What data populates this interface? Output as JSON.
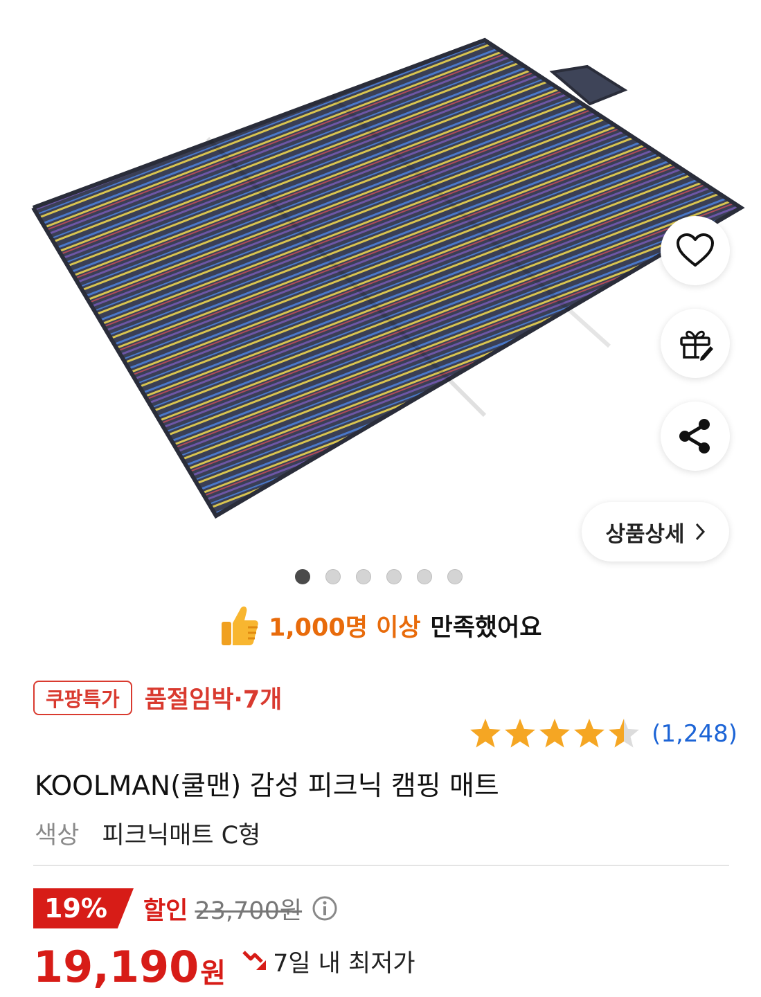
{
  "product_image": {
    "alt": "",
    "colors": {
      "mat_base": "#3a3f55",
      "stripe_blue": "#4a78c8",
      "stripe_yellow": "#d8c450",
      "stripe_red": "#b04a5a",
      "stripe_purple": "#6d56a6"
    }
  },
  "actions": {
    "wishlist_icon": "heart-icon",
    "gift_icon": "gift-icon",
    "share_icon": "share-icon",
    "detail_label": "상품상세"
  },
  "gallery": {
    "current": 1,
    "total": 6
  },
  "satisfaction": {
    "count_text": "1,000명 이상",
    "rest_text": "만족했어요",
    "icon": "thumbs-up-icon"
  },
  "badge": {
    "label": "쿠팡특가",
    "stock_text": "품절임박·7개"
  },
  "rating": {
    "stars": 4.5,
    "count_text": "(1,248)",
    "star_color": "#f5a623"
  },
  "product": {
    "title": "KOOLMAN(쿨맨) 감성 피크닉 캠핑 매트",
    "option_key": "색상",
    "option_value": "피크닉매트 C형"
  },
  "price": {
    "discount": "19%",
    "sale_label": "할인",
    "original": "23,700원",
    "current": "19,190",
    "currency": "원",
    "lowest_label": "7일 내 최저가",
    "accent": "#d71c17"
  }
}
